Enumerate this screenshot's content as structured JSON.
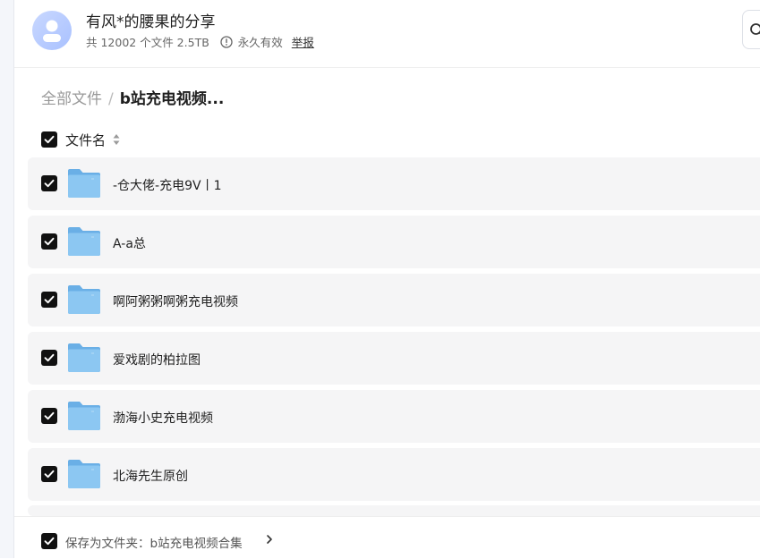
{
  "header": {
    "title": "有风*的腰果的分享",
    "file_count": "共 12002 个文件 2.5TB",
    "validity": "永久有效",
    "report_label": "举报"
  },
  "breadcrumb": {
    "root": "全部文件",
    "separator": "/",
    "current": "b站充电视频..."
  },
  "list": {
    "column_name": "文件名",
    "rows": [
      {
        "name": "-仓大佬-充电9V丨1"
      },
      {
        "name": "A-a总"
      },
      {
        "name": "啊阿粥粥啊粥充电视频"
      },
      {
        "name": "爱戏剧的柏拉图"
      },
      {
        "name": "渤海小史充电视频"
      },
      {
        "name": "北海先生原创"
      }
    ]
  },
  "footer": {
    "save_label": "保存为文件夹：b站充电视频合集"
  },
  "icons": {
    "avatar": "user-avatar-icon",
    "info": "info-icon",
    "search": "search-icon",
    "sort": "sort-icon",
    "folder": "folder-icon",
    "checkbox": "checkbox-checked-icon",
    "chevron": "chevron-right-icon"
  },
  "colors": {
    "accent_checkbox": "#111111",
    "folder": "#7ab8ec",
    "row_background": "#f5f5f6"
  }
}
